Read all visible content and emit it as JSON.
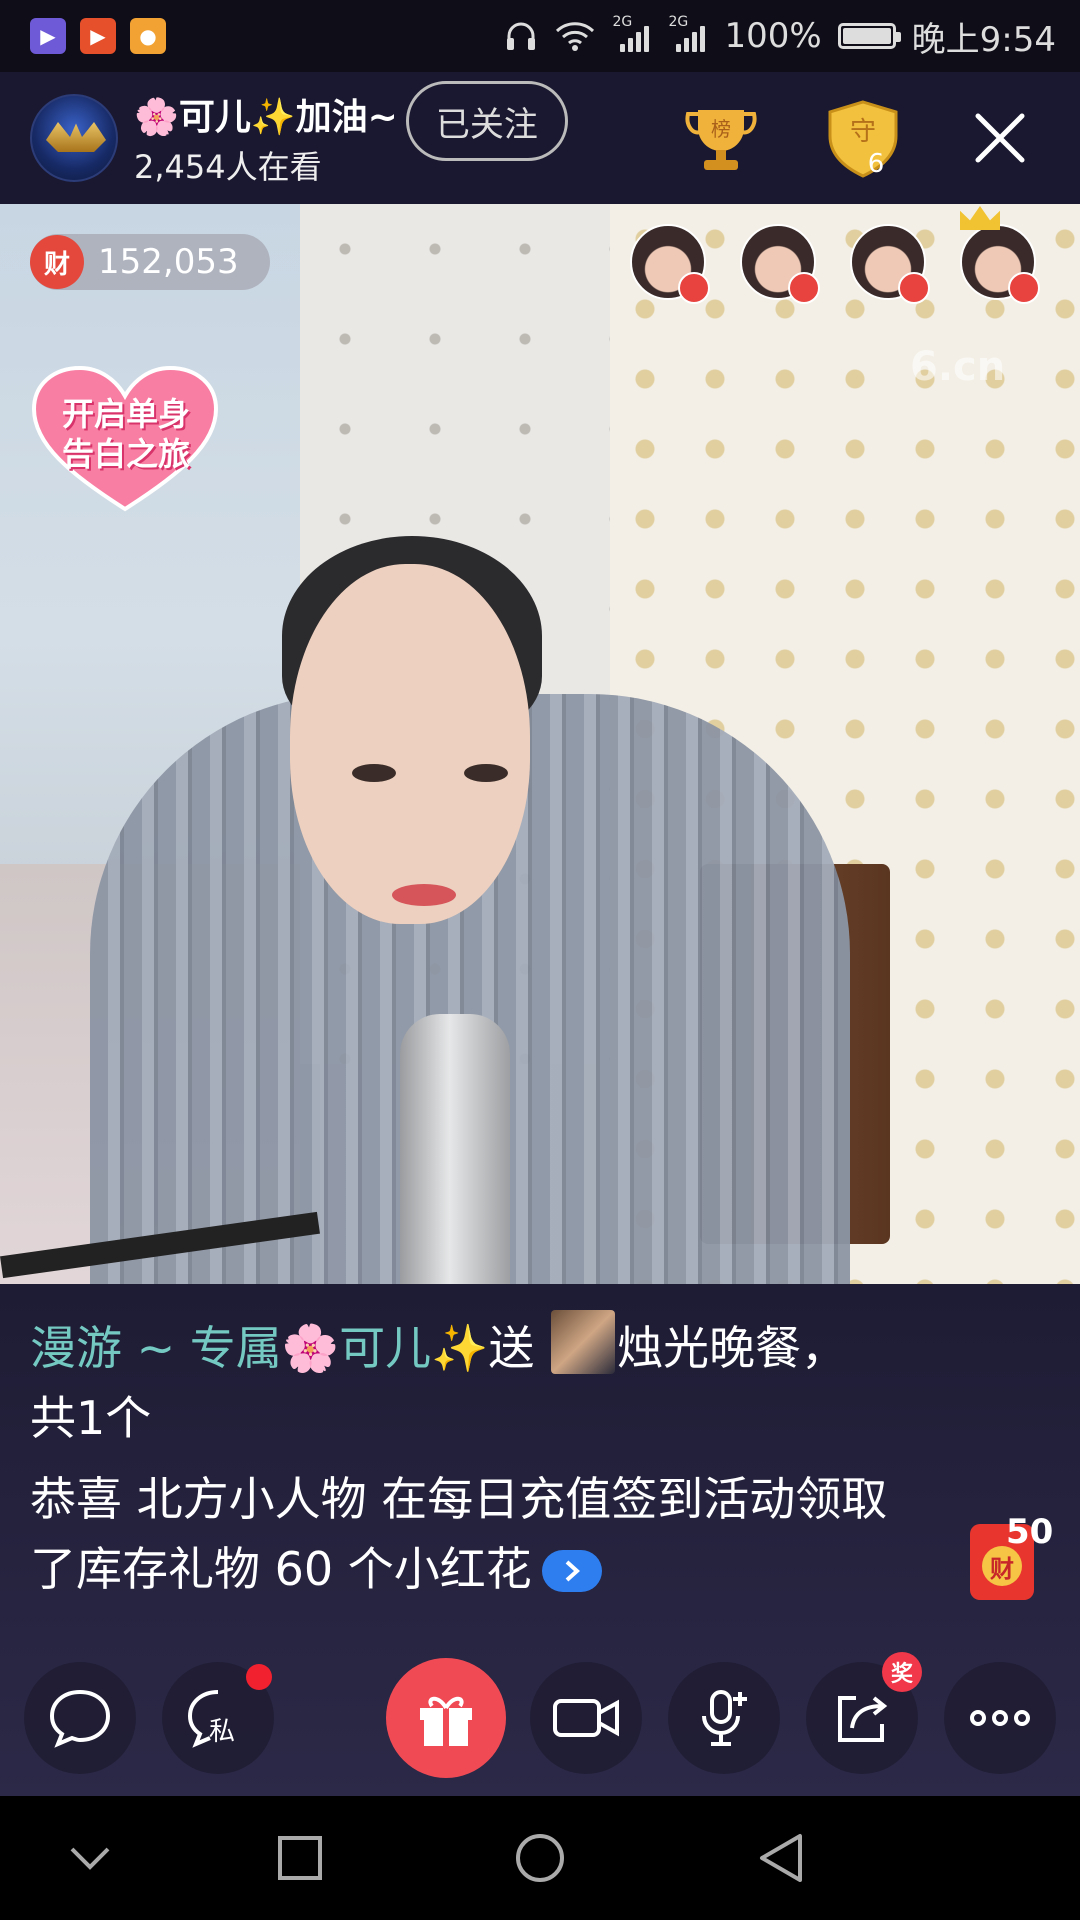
{
  "status_bar": {
    "apps": [
      "video-app-icon",
      "youtube-icon",
      "kuaishou-icon"
    ],
    "network_label_1": "2G",
    "network_label_2": "2G",
    "battery": "100%",
    "time": "晚上9:54",
    "battery_level": 1.0
  },
  "header": {
    "streamer_name": "🌸可儿✨加油~",
    "viewers": "2,454人在看",
    "follow_label": "已关注",
    "trophy_label": "榜",
    "guard_label": "守",
    "guard_count": "6"
  },
  "video": {
    "wealth_label": "财",
    "wealth_value": "152,053",
    "promo_line1": "开启单身",
    "promo_line2": "告白之旅",
    "watermark": "6.cn"
  },
  "chat": {
    "msg1_user": "漫游 ~ 专属",
    "msg1_flower": "🌸",
    "msg1_name": "可儿",
    "msg1_spark": "✨",
    "msg1_verb": "送 ",
    "msg1_gift": "烛光晚餐，共1个",
    "msg2": "恭喜 北方小人物 在每日充值签到活动领取了库存礼物 60 个小红花",
    "red_packet_label": "财",
    "red_packet_count": "50"
  },
  "toolbar": {
    "private_label": "私",
    "share_badge": "奖"
  },
  "colors": {
    "accent_gift": "#f04a55",
    "chat_teal": "#74c9c2",
    "link_blue": "#2e7ef0"
  }
}
